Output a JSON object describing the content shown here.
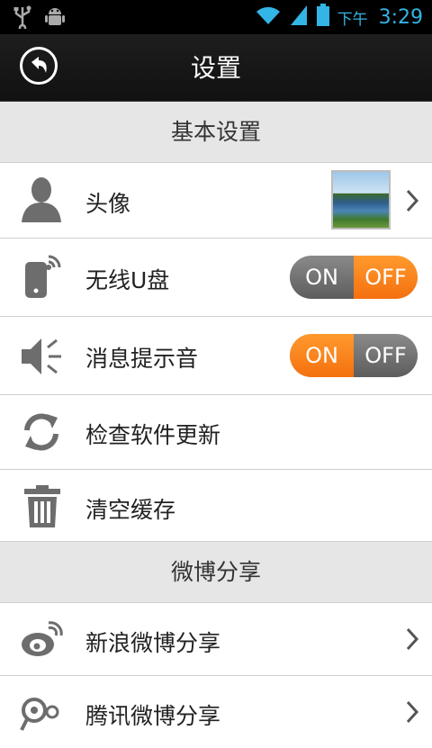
{
  "status_bar": {
    "ampm": "下午",
    "time": "3:29",
    "icons": [
      "usb-icon",
      "android-debug-icon",
      "wifi-icon",
      "signal-icon",
      "battery-icon"
    ]
  },
  "header": {
    "title": "设置"
  },
  "sections": [
    {
      "title": "基本设置",
      "items": [
        {
          "label": "头像",
          "icon": "person-icon",
          "control": "avatar-chevron"
        },
        {
          "label": "无线U盘",
          "icon": "wireless-disk-icon",
          "control": "toggle",
          "state": "off",
          "on_label": "ON",
          "off_label": "OFF"
        },
        {
          "label": "消息提示音",
          "icon": "speaker-icon",
          "control": "toggle",
          "state": "on",
          "on_label": "ON",
          "off_label": "OFF"
        },
        {
          "label": "检查软件更新",
          "icon": "refresh-icon",
          "control": "none"
        },
        {
          "label": "清空缓存",
          "icon": "trash-icon",
          "control": "none"
        }
      ]
    },
    {
      "title": "微博分享",
      "items": [
        {
          "label": "新浪微博分享",
          "icon": "sina-weibo-icon",
          "control": "chevron"
        },
        {
          "label": "腾讯微博分享",
          "icon": "tencent-weibo-icon",
          "control": "chevron"
        }
      ]
    }
  ],
  "colors": {
    "accent_orange": "#f4700f",
    "toggle_grey": "#6d6d6d",
    "status_blue": "#33b5e5"
  }
}
